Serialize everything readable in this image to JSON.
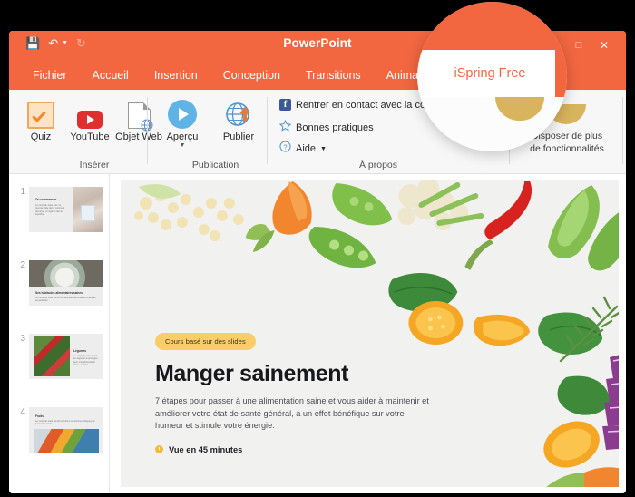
{
  "window": {
    "app_title": "PowerPoint",
    "quick_access": [
      {
        "name": "save",
        "glyph": "💾"
      },
      {
        "name": "undo",
        "glyph": "↶"
      },
      {
        "name": "redo",
        "glyph": "↻"
      }
    ],
    "controls": {
      "minimize": "—",
      "maximize": "□",
      "close": "✕"
    },
    "tabs": [
      {
        "label": "Fichier",
        "active": false
      },
      {
        "label": "Accueil",
        "active": false
      },
      {
        "label": "Insertion",
        "active": false
      },
      {
        "label": "Conception",
        "active": false
      },
      {
        "label": "Transitions",
        "active": false
      },
      {
        "label": "Animations",
        "active": false
      },
      {
        "label": "iSpring Free",
        "active": true
      }
    ]
  },
  "ribbon": {
    "groups": [
      {
        "title": "Insérer"
      },
      {
        "title": "Publication"
      },
      {
        "title": "À propos"
      }
    ],
    "buttons": [
      {
        "label": "Quiz",
        "icon": "quiz-icon",
        "dropdown": false
      },
      {
        "label": "YouTube",
        "icon": "youtube-icon",
        "dropdown": false
      },
      {
        "label": "Objet Web",
        "icon": "web-object-icon",
        "dropdown": false
      },
      {
        "label": "Aperçu",
        "icon": "preview-play-icon",
        "dropdown": true
      },
      {
        "label": "Publier",
        "icon": "publish-globe-icon",
        "dropdown": false
      }
    ],
    "about_items": [
      {
        "label": "Rentrer en contact avec la communauté",
        "icon": "facebook-icon"
      },
      {
        "label": "Bonnes pratiques",
        "icon": "star-icon"
      },
      {
        "label": "Aide",
        "icon": "help-icon",
        "dropdown": true
      }
    ],
    "upgrade_text_line1": "Disposer de plus",
    "upgrade_text_line2": "de fonctionnalités"
  },
  "thumbnails": [
    {
      "number": "1",
      "title": "Où commencer",
      "body": "Le corps du texte pour ce premier slide décrit comment démarrer un régime sain et équilibré.",
      "layout": "text-left-image-right"
    },
    {
      "number": "2",
      "title": "Ses habitudes alimentaires saines",
      "body": "Le corps du texte décrit les habitudes alimentaires à adopter au quotidien.",
      "layout": "image-top-text-bottom"
    },
    {
      "number": "3",
      "title": "Légumes",
      "body": "Le corps du texte décrit les légumes à privilégier pour une alimentation saine et variée.",
      "layout": "image-left-text-right"
    },
    {
      "number": "4",
      "title": "Fruits",
      "body": "Le corps du texte décrit les fruits à consommer chaque jour pour votre santé.",
      "layout": "text-top-image-bottom"
    }
  ],
  "slide": {
    "badge": "Cours basé sur des slides",
    "title": "Manger sainement",
    "description": "7 étapes pour passer à une alimentation saine et vous aider à maintenir et améliorer votre état de santé général, a un effet bénéfique sur votre humeur et stimule votre énergie.",
    "duration": "Vue en 45 minutes"
  },
  "magnifier": {
    "tab_label": "iSpring Free"
  },
  "colors": {
    "brand_orange": "#F26740",
    "badge_yellow": "#F9CE68",
    "clock_yellow": "#F4B942",
    "ribbon_bg": "#F7F7F7"
  }
}
